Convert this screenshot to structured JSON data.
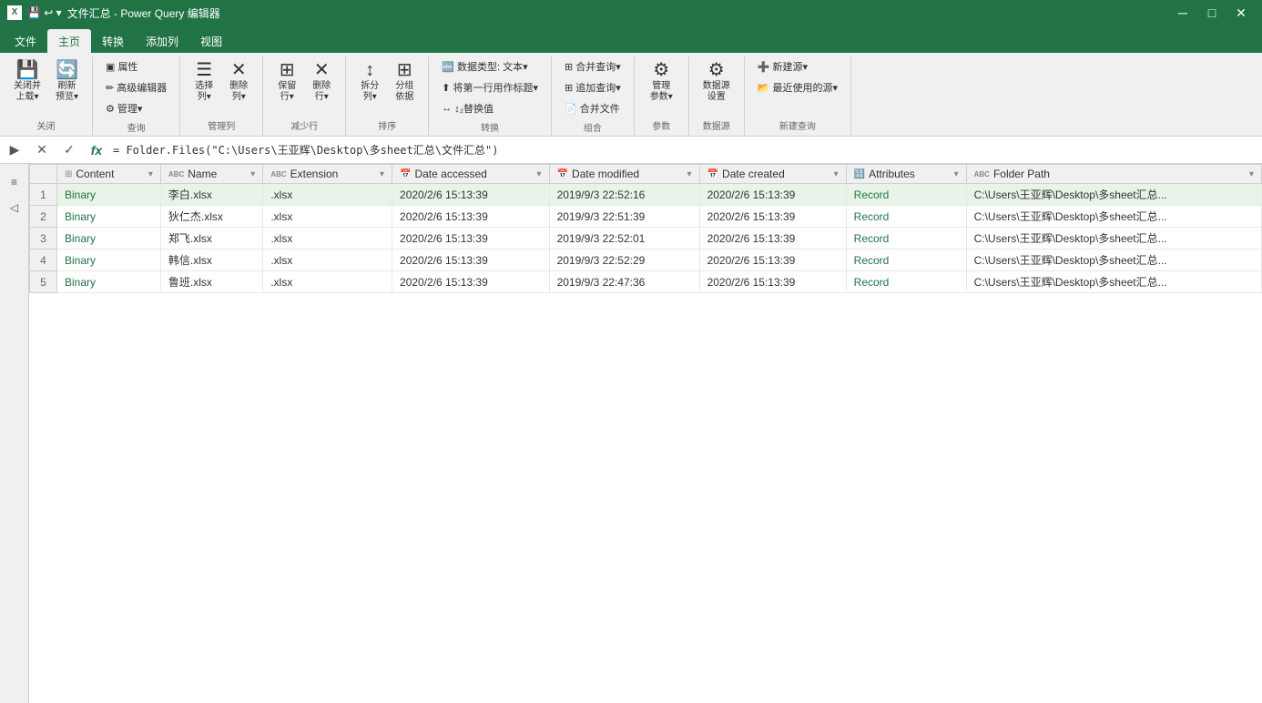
{
  "titleBar": {
    "appName": "文件汇总 - Power Query 编辑器",
    "icon": "X",
    "buttons": [
      "—",
      "□",
      "×"
    ]
  },
  "ribbonTabs": [
    {
      "label": "文件",
      "active": false
    },
    {
      "label": "主页",
      "active": true
    },
    {
      "label": "转换",
      "active": false
    },
    {
      "label": "添加列",
      "active": false
    },
    {
      "label": "视图",
      "active": false
    }
  ],
  "ribbon": {
    "groups": [
      {
        "label": "关闭",
        "buttons": [
          {
            "icon": "💾",
            "label": "关闭并\n上载▾",
            "type": "large"
          },
          {
            "icon": "🔄",
            "label": "刷新\n预览▾",
            "type": "large"
          }
        ]
      },
      {
        "label": "查询",
        "buttons": [
          {
            "icon": "▣",
            "label": "属性",
            "type": "small"
          },
          {
            "icon": "✏",
            "label": "高级编辑器",
            "type": "small"
          },
          {
            "icon": "⚙",
            "label": "管理▾",
            "type": "small"
          }
        ]
      },
      {
        "label": "管理列",
        "buttons": [
          {
            "icon": "☰",
            "label": "选择\n列▾",
            "type": "large"
          },
          {
            "icon": "✕",
            "label": "删除\n列▾",
            "type": "large"
          }
        ]
      },
      {
        "label": "减少行",
        "buttons": [
          {
            "icon": "⊞",
            "label": "保留\n行▾",
            "type": "large"
          },
          {
            "icon": "✕",
            "label": "删除\n行▾",
            "type": "large"
          }
        ]
      },
      {
        "label": "排序",
        "buttons": [
          {
            "icon": "↕",
            "label": "拆分\n列▾",
            "type": "large"
          },
          {
            "icon": "⊞",
            "label": "分组\n依据",
            "type": "large"
          }
        ]
      },
      {
        "label": "转换",
        "buttons": [
          {
            "icon": "🔤",
            "label": "数据类型: 文本▾",
            "type": "small"
          },
          {
            "icon": "⬆",
            "label": "将第一行用作标题▾",
            "type": "small"
          },
          {
            "icon": "↔",
            "label": "替换值",
            "type": "small"
          }
        ]
      },
      {
        "label": "组合",
        "buttons": [
          {
            "icon": "⊞",
            "label": "合并查询▾",
            "type": "small"
          },
          {
            "icon": "⊞",
            "label": "追加查询▾",
            "type": "small"
          },
          {
            "icon": "📄",
            "label": "合并文件",
            "type": "small"
          }
        ]
      },
      {
        "label": "参数",
        "buttons": [
          {
            "icon": "⚙",
            "label": "管理\n参数▾",
            "type": "large"
          }
        ]
      },
      {
        "label": "数据源",
        "buttons": [
          {
            "icon": "⚙",
            "label": "数据源\n设置",
            "type": "large"
          }
        ]
      },
      {
        "label": "新建查询",
        "buttons": [
          {
            "icon": "➕",
            "label": "新建源▾",
            "type": "small"
          },
          {
            "icon": "📂",
            "label": "最近使用的源▾",
            "type": "small"
          }
        ]
      }
    ]
  },
  "formulaBar": {
    "formula": "= Folder.Files(\"C:\\Users\\王亚辉\\Desktop\\多sheet汇总\\文件汇总\")"
  },
  "table": {
    "columns": [
      {
        "icon": "⊞",
        "type": "binary",
        "label": "Content",
        "hasDropdown": true
      },
      {
        "icon": "ABC",
        "type": "text",
        "label": "Name",
        "hasDropdown": true
      },
      {
        "icon": "ABC",
        "type": "text",
        "label": "Extension",
        "hasDropdown": true
      },
      {
        "icon": "📅",
        "type": "date",
        "label": "Date accessed",
        "hasDropdown": true
      },
      {
        "icon": "📅",
        "type": "date",
        "label": "Date modified",
        "hasDropdown": true
      },
      {
        "icon": "📅",
        "type": "date",
        "label": "Date created",
        "hasDropdown": true
      },
      {
        "icon": "🔢",
        "type": "num",
        "label": "Attributes",
        "hasDropdown": true
      },
      {
        "icon": "ABC",
        "type": "text",
        "label": "Folder Path",
        "hasDropdown": true
      }
    ],
    "rows": [
      {
        "num": 1,
        "content": "Binary",
        "name": "李白.xlsx",
        "extension": ".xlsx",
        "dateAccessed": "2020/2/6 15:13:39",
        "dateModified": "2019/9/3 22:52:16",
        "dateCreated": "2020/2/6 15:13:39",
        "attributes": "Record",
        "folderPath": "C:\\Users\\王亚辉\\Desktop\\多sheet汇总...",
        "selected": true
      },
      {
        "num": 2,
        "content": "Binary",
        "name": "狄仁杰.xlsx",
        "extension": ".xlsx",
        "dateAccessed": "2020/2/6 15:13:39",
        "dateModified": "2019/9/3 22:51:39",
        "dateCreated": "2020/2/6 15:13:39",
        "attributes": "Record",
        "folderPath": "C:\\Users\\王亚辉\\Desktop\\多sheet汇总..."
      },
      {
        "num": 3,
        "content": "Binary",
        "name": "郑飞.xlsx",
        "extension": ".xlsx",
        "dateAccessed": "2020/2/6 15:13:39",
        "dateModified": "2019/9/3 22:52:01",
        "dateCreated": "2020/2/6 15:13:39",
        "attributes": "Record",
        "folderPath": "C:\\Users\\王亚辉\\Desktop\\多sheet汇总..."
      },
      {
        "num": 4,
        "content": "Binary",
        "name": "韩信.xlsx",
        "extension": ".xlsx",
        "dateAccessed": "2020/2/6 15:13:39",
        "dateModified": "2019/9/3 22:52:29",
        "dateCreated": "2020/2/6 15:13:39",
        "attributes": "Record",
        "folderPath": "C:\\Users\\王亚辉\\Desktop\\多sheet汇总..."
      },
      {
        "num": 5,
        "content": "Binary",
        "name": "鲁班.xlsx",
        "extension": ".xlsx",
        "dateAccessed": "2020/2/6 15:13:39",
        "dateModified": "2019/9/3 22:47:36",
        "dateCreated": "2020/2/6 15:13:39",
        "attributes": "Record",
        "folderPath": "C:\\Users\\王亚辉\\Desktop\\多sheet汇总..."
      }
    ]
  }
}
